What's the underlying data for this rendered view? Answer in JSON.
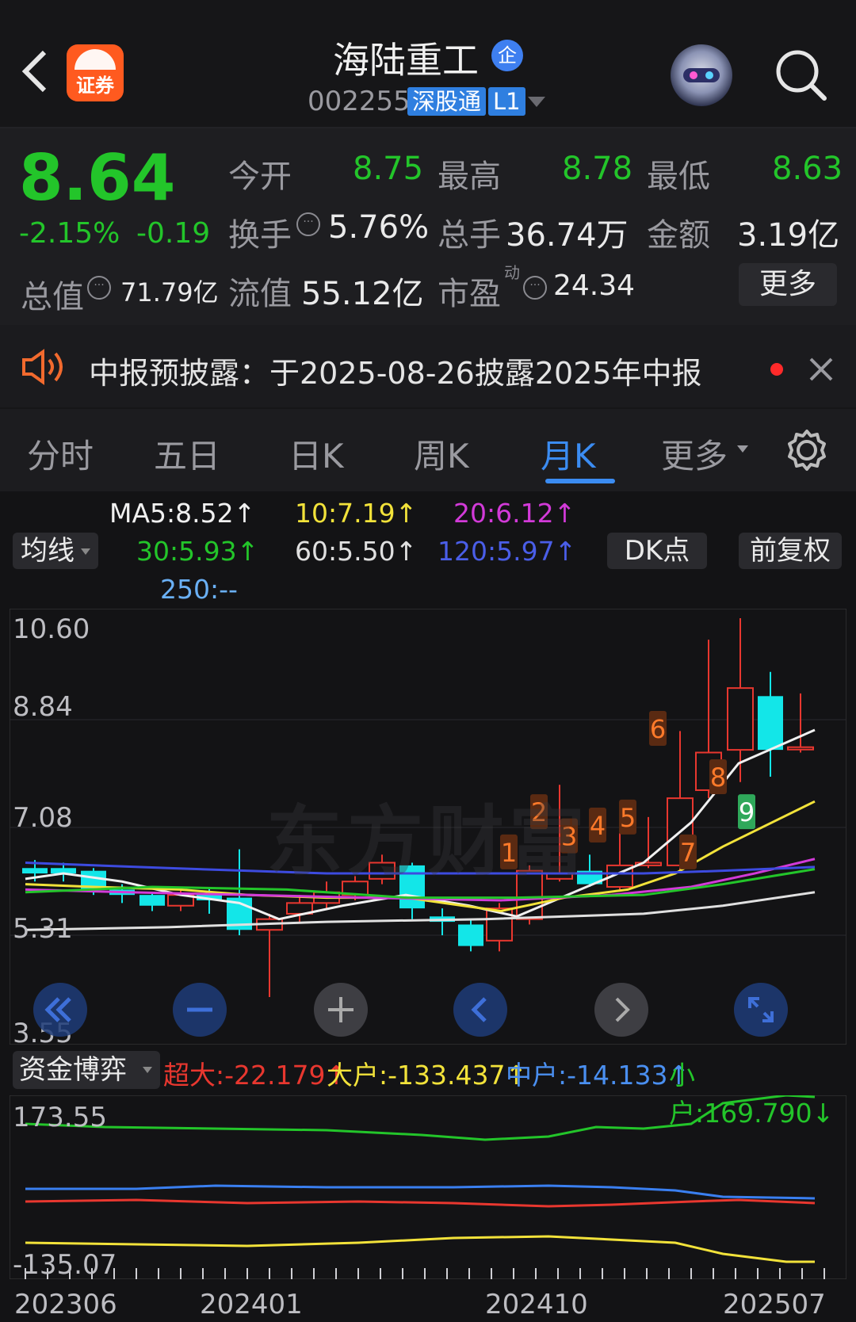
{
  "header": {
    "stock_name": "海陆重工",
    "enterprise_badge": "企",
    "stock_code": "002255",
    "connect_tag": "深股通",
    "level_tag": "L1",
    "broker_logo_text": "证券"
  },
  "quote": {
    "price": "8.64",
    "change_pct": "-2.15%",
    "change_abs": "-0.19",
    "open_label": "今开",
    "open": "8.75",
    "high_label": "最高",
    "high": "8.78",
    "low_label": "最低",
    "low": "8.63",
    "turnover_label": "换手",
    "turnover": "5.76%",
    "volume_label": "总手",
    "volume": "36.74万",
    "amount_label": "金额",
    "amount": "3.19亿",
    "mktcap_label": "总值",
    "mktcap": "71.79亿",
    "float_label": "流值",
    "float": "55.12亿",
    "pe_label": "市盈",
    "pe_sup": "动",
    "pe": "24.34",
    "more_label": "更多"
  },
  "notice": {
    "text": "中报预披露：于2025-08-26披露2025年中报"
  },
  "tabs": [
    "分时",
    "五日",
    "日K",
    "周K",
    "月K",
    "更多"
  ],
  "active_tab": "月K",
  "indicators": {
    "ma5": "MA5:8.52",
    "ma10": "10:7.19",
    "ma20": "20:6.12",
    "ma30": "30:5.93",
    "ma60": "60:5.50",
    "ma120": "120:5.97",
    "ma250": "250:--",
    "arrow": "↑",
    "ma_select": "均线",
    "dk_label": "DK点",
    "adjust_label": "前复权"
  },
  "main_chart": {
    "y_labels": [
      "10.60",
      "8.84",
      "7.08",
      "5.31",
      "3.55"
    ],
    "watermark": "东方财富",
    "markers": [
      "1",
      "2",
      "3",
      "4",
      "5",
      "6",
      "7",
      "8",
      "9"
    ]
  },
  "fund_panel": {
    "select_label": "资金博弈",
    "super": "超大:-22.179",
    "big": "大户:-133.437",
    "mid": "中户:-14.133",
    "small": "小户:169.790",
    "up_arrow": "↑",
    "down_arrow": "↓",
    "y_top": "173.55",
    "y_bottom": "-135.07"
  },
  "x_labels": [
    "202306",
    "202401",
    "202410",
    "202507"
  ],
  "colors": {
    "up": "#e8372f",
    "down": "#13e6e8",
    "green": "#23c52a",
    "accent": "#3b8cf2"
  },
  "chart_data": {
    "type": "candlestick",
    "categories": [],
    "ylim": [
      3.55,
      10.6
    ],
    "series": []
  }
}
